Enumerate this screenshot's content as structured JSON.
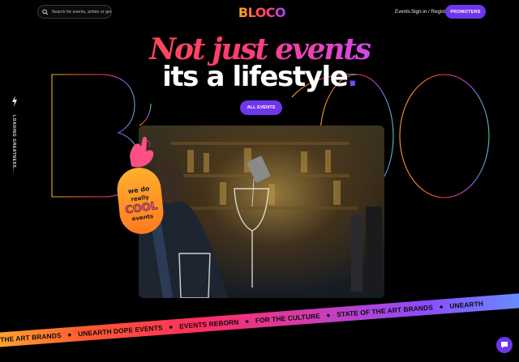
{
  "header": {
    "search_placeholder": "Search for events, artists or greatness",
    "logo_text": "BLOCO",
    "nav": {
      "events": "Events",
      "signin": "Sign-in / Register"
    },
    "promoters_label": "PROMOTERS"
  },
  "hero": {
    "headline_1": "Not just events",
    "headline_2": "its a lifestyle",
    "headline_2_dot": ".",
    "background_word": "BLOCO",
    "all_events_label": "ALL EVENTS",
    "loading_text": "LOADING GREATNESS..."
  },
  "sticker": {
    "line_1": "we do",
    "line_2": "really",
    "line_3": "COOL",
    "line_4": "events"
  },
  "ticker": {
    "items": [
      "OF THE ART BRANDS",
      "UNEARTH DOPE EVENTS",
      "EVENTS REBORN",
      "FOR THE CULTURE",
      "STATE OF THE ART BRANDS",
      "UNEARTH"
    ]
  },
  "colors": {
    "accent": "#6f36ee",
    "headline_gradient": [
      "#ff5a2f",
      "#ff3d6e",
      "#d04aff",
      "#8b53ff"
    ]
  },
  "icons": {
    "search": "search-icon",
    "bolt": "bolt-icon",
    "chat": "chat-icon"
  }
}
